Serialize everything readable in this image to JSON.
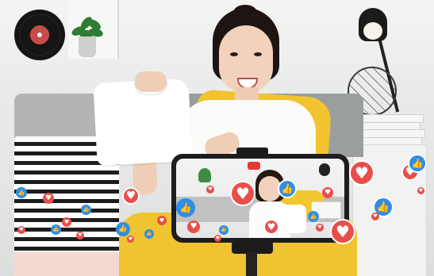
{
  "image": {
    "subject": "Woman holding a white t-shirt while livestreaming from a smartphone on a tripod",
    "scene_elements": [
      "vinyl record on wall",
      "potted plant on shelf",
      "grey sofa",
      "yellow cushion",
      "striped blanket",
      "black lamp",
      "stack of books",
      "wire cage lamp",
      "smartphone on tripod"
    ]
  },
  "colors": {
    "heart": "#e84f4a",
    "like": "#2f8ee8",
    "cushion": "#f1c42f",
    "shirt": "#ffffff",
    "sofa": "#9a9e9d",
    "phone": "#1d1d1f",
    "record_label": "#c84c4a"
  },
  "reactions": {
    "heart_icon": "heart-icon",
    "like_icon": "thumbs-up-icon",
    "heart_glyph": "♥",
    "like_glyph": "👍"
  },
  "phone_screen": {
    "recording_indicator_color": "#e53935"
  }
}
